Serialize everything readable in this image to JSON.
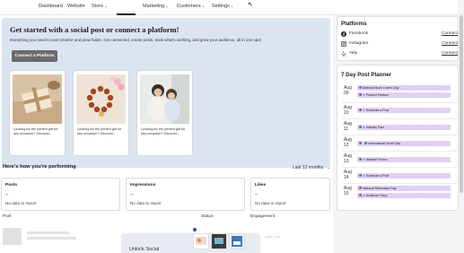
{
  "nav": {
    "items": [
      {
        "label": "Dashboard",
        "chevron": false
      },
      {
        "label": "Website",
        "chevron": false
      },
      {
        "label": "Store",
        "chevron": true
      },
      {
        "label": "",
        "chevron": false
      },
      {
        "label": "Marketing",
        "chevron": true
      },
      {
        "label": "Customers",
        "chevron": true
      },
      {
        "label": "Settings",
        "chevron": true
      }
    ]
  },
  "hero": {
    "title": "Get started with a social post or connect a platform!",
    "subtitle": "Everything you need to post smarter and grow faster. Get connected, create posts, track what's working, and grow your audience, all in one spot",
    "connect_button": "Connect a Platform",
    "posts": [
      {
        "text": "Looking for the perfect gift for any occasion? Discover..."
      },
      {
        "text": "Looking for the perfect gift for any occasion? Discover..."
      },
      {
        "text": "Looking for the perfect gift for any occasion? Discover..."
      }
    ]
  },
  "performance": {
    "title": "Here's how you're performing",
    "range": "Last 12 months",
    "metrics": [
      {
        "label": "Posts",
        "value": "--",
        "note": "No data to report"
      },
      {
        "label": "Impressions",
        "value": "--",
        "note": "No data to report"
      },
      {
        "label": "Likes",
        "value": "--",
        "note": "No data to report"
      }
    ],
    "columns": {
      "post": "Post",
      "status": "Status",
      "engagement": "Engagement"
    },
    "unlock_text": "Unlock Social"
  },
  "platforms": {
    "title": "Platforms",
    "items": [
      {
        "name": "Facebook",
        "link": "Connect",
        "icon": "facebook-icon"
      },
      {
        "name": "Instagram",
        "link": "Connect",
        "icon": "instagram-icon"
      },
      {
        "name": "Yelp",
        "link": "Connect",
        "icon": "yelp-icon"
      }
    ]
  },
  "planner": {
    "title": "7 Day Post Planner",
    "days": [
      {
        "month": "Aug",
        "day": "09",
        "events": [
          {
            "type": "dot",
            "label": "National Book Lovers Day"
          },
          {
            "type": "spark",
            "label": "Product Feature"
          }
        ]
      },
      {
        "month": "Aug",
        "day": "10",
        "events": [
          {
            "type": "spark",
            "label": "Schedule a Post"
          }
        ]
      },
      {
        "month": "Aug",
        "day": "11",
        "events": [
          {
            "type": "spark",
            "label": "Industry Fact"
          }
        ]
      },
      {
        "month": "Aug",
        "day": "12",
        "events": [
          {
            "type": "dot",
            "label": "International Youth Day"
          }
        ]
      },
      {
        "month": "Aug",
        "day": "13",
        "events": [
          {
            "type": "spark",
            "label": "Website Promo"
          }
        ]
      },
      {
        "month": "Aug",
        "day": "14",
        "events": [
          {
            "type": "spark",
            "label": "Schedule a Post"
          }
        ]
      },
      {
        "month": "Aug",
        "day": "15",
        "events": [
          {
            "type": "dot",
            "label": "National Relaxation Day"
          },
          {
            "type": "spark",
            "label": "Audience Story"
          }
        ]
      }
    ]
  }
}
